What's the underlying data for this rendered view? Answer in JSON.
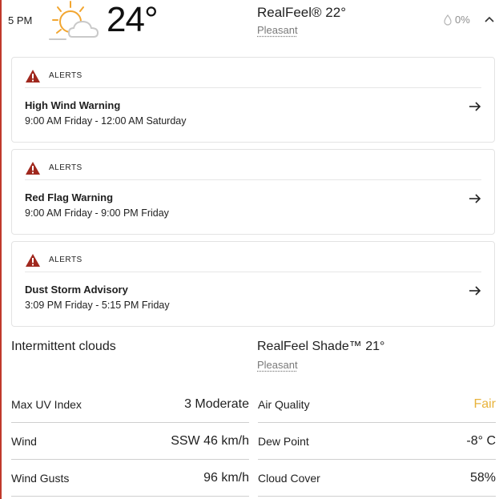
{
  "header": {
    "hour": "5 PM",
    "weather_icon": "partly-sunny-icon",
    "temperature": "24°",
    "realfeel": "RealFeel® 22°",
    "realfeel_phrase": "Pleasant",
    "precip_icon": "raindrop-icon",
    "precip": "0%",
    "toggle_icon": "chevron-up-icon"
  },
  "alerts": [
    {
      "label": "ALERTS",
      "title": "High Wind Warning",
      "time": "9:00 AM Friday - 12:00 AM Saturday"
    },
    {
      "label": "ALERTS",
      "title": "Red Flag Warning",
      "time": "9:00 AM Friday - 9:00 PM Friday"
    },
    {
      "label": "ALERTS",
      "title": "Dust Storm Advisory",
      "time": "3:09 PM Friday - 5:15 PM Friday"
    }
  ],
  "details": {
    "condition": "Intermittent clouds",
    "realfeel_shade": "RealFeel Shade™ 21°",
    "realfeel_shade_phrase": "Pleasant",
    "left": [
      {
        "label": "Max UV Index",
        "value": "3 Moderate"
      },
      {
        "label": "Wind",
        "value": "SSW 46 km/h"
      },
      {
        "label": "Wind Gusts",
        "value": "96 km/h"
      }
    ],
    "right": [
      {
        "label": "Air Quality",
        "value": "Fair"
      },
      {
        "label": "Dew Point",
        "value": "-8° C"
      },
      {
        "label": "Cloud Cover",
        "value": "58%"
      }
    ]
  },
  "colors": {
    "alert_red": "#a0281e",
    "air_quality_fair": "#e8b33c",
    "sun_orange": "#f2a630"
  }
}
